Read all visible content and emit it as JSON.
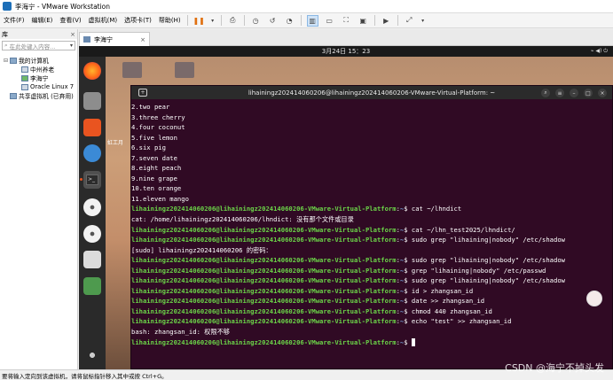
{
  "window": {
    "title": "李海宁 - VMware Workstation"
  },
  "menu": {
    "items": [
      "文件(F)",
      "编辑(E)",
      "查看(V)",
      "虚拟机(M)",
      "选项卡(T)",
      "帮助(H)"
    ]
  },
  "library": {
    "header": "库",
    "close": "×",
    "search_placeholder": "在此处键入内容...",
    "tree": [
      {
        "label": "我的计算机",
        "level": 1
      },
      {
        "label": "中州养老",
        "level": 2
      },
      {
        "label": "李海宁",
        "level": 2
      },
      {
        "label": "Oracle Linux 7",
        "level": 2
      },
      {
        "label": "共享虚拟机 (已弃用)",
        "level": 1
      }
    ]
  },
  "tab": {
    "label": "李海宁",
    "close": "×"
  },
  "guest": {
    "clock": "3月24日  15：23",
    "desktop_label": "虹工月"
  },
  "terminal": {
    "title": "lihainingz202414060206@lihainingz202414060206-VMware-Virtual-Platform: ~",
    "lines": [
      {
        "text": "2.two pear"
      },
      {
        "text": "3.three cherry"
      },
      {
        "text": "4.four coconut"
      },
      {
        "text": "5.five lemon"
      },
      {
        "text": "6.six pig"
      },
      {
        "text": "7.seven date"
      },
      {
        "text": "8.eight peach"
      },
      {
        "text": "9.nine grape"
      },
      {
        "text": "10.ten orange"
      },
      {
        "text": "11.eleven mango"
      },
      {
        "user": "lihainingz202414060206@lihainingz202414060206-VMware-Virtual-Platform",
        "path": "~",
        "cmd": "$ cat ~/lhndict"
      },
      {
        "text": "cat: /home/lihainingz202414060206/lhndict: 没有那个文件或目录"
      },
      {
        "user": "lihainingz202414060206@lihainingz202414060206-VMware-Virtual-Platform",
        "path": "~",
        "cmd": "$ cat ~/lhn_test2025/lhndict/"
      },
      {
        "user": "lihainingz202414060206@lihainingz202414060206-VMware-Virtual-Platform",
        "path": "~",
        "cmd": "$ sudo grep \"lihaining|nobody\" /etc/shadow"
      },
      {
        "text": "[sudo] lihainingz202414060206 的密码："
      },
      {
        "user": "lihainingz202414060206@lihainingz202414060206-VMware-Virtual-Platform",
        "path": "~",
        "cmd": "$ sudo grep \"lihaining|nobody\" /etc/shadow"
      },
      {
        "user": "lihainingz202414060206@lihainingz202414060206-VMware-Virtual-Platform",
        "path": "~",
        "cmd": "$ grep \"lihaining|nobody\" /etc/passwd"
      },
      {
        "user": "lihainingz202414060206@lihainingz202414060206-VMware-Virtual-Platform",
        "path": "~",
        "cmd": "$ sudo grep \"lihaining|nobody\" /etc/shadow"
      },
      {
        "user": "lihainingz202414060206@lihainingz202414060206-VMware-Virtual-Platform",
        "path": "~",
        "cmd": "$ id > zhangsan_id"
      },
      {
        "user": "lihainingz202414060206@lihainingz202414060206-VMware-Virtual-Platform",
        "path": "~",
        "cmd": "$ date >> zhangsan_id"
      },
      {
        "user": "lihainingz202414060206@lihainingz202414060206-VMware-Virtual-Platform",
        "path": "~",
        "cmd": "$ chmod 440 zhangsan_id"
      },
      {
        "user": "lihainingz202414060206@lihainingz202414060206-VMware-Virtual-Platform",
        "path": "~",
        "cmd": "$ echo \"test\" >> zhangsan_id"
      },
      {
        "text": "bash: zhangsan_id: 权限不够"
      },
      {
        "user": "lihainingz202414060206@lihainingz202414060206-VMware-Virtual-Platform",
        "path": "~",
        "cmd": "$ ",
        "cursor": true
      }
    ]
  },
  "statusbar": {
    "text": "要将输入定向到该虚拟机，请将鼠标指针移入其中或按 Ctrl+G。"
  },
  "watermark": "CSDN @海宁不掉头发"
}
